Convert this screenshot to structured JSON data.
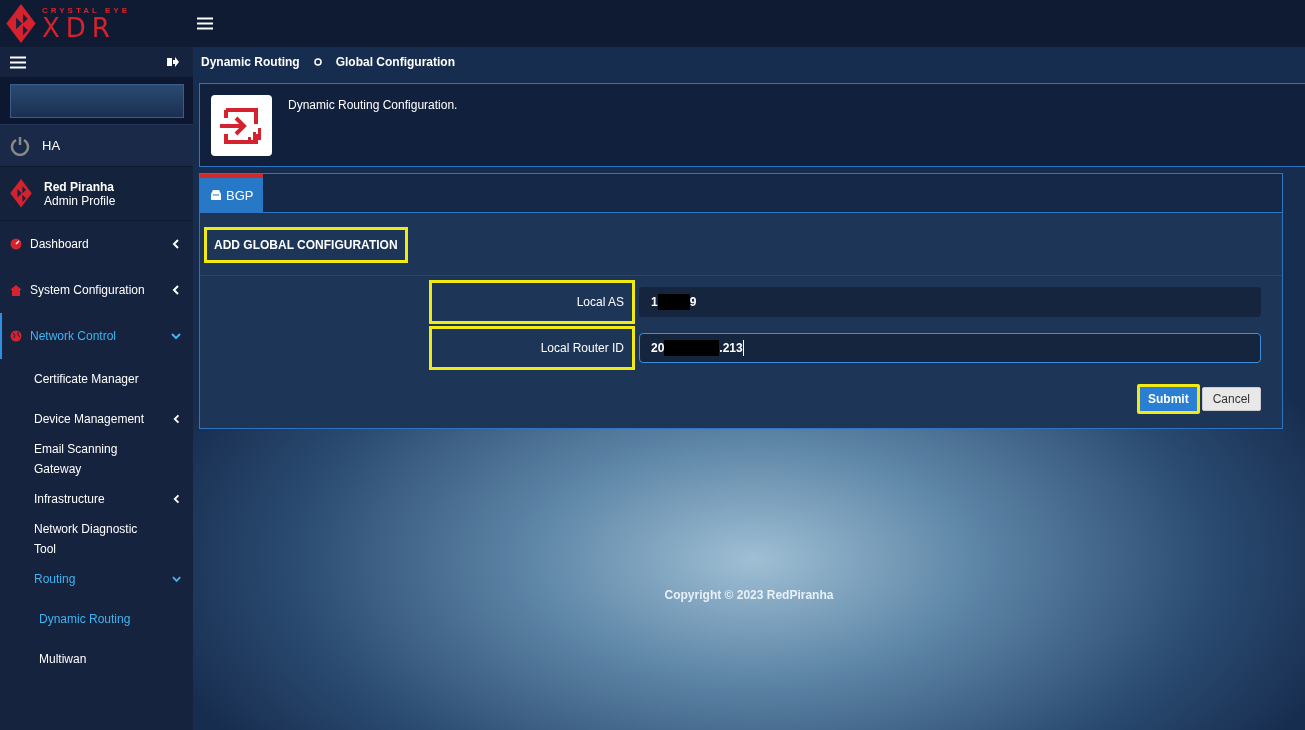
{
  "logo": {
    "tagline": "CRYSTAL EYE",
    "wordmark": "XDR"
  },
  "sidebar": {
    "ha_label": "HA",
    "profile": {
      "name": "Red Piranha",
      "role": "Admin Profile"
    },
    "items": [
      {
        "label": "Dashboard",
        "expanded": false,
        "selected": false
      },
      {
        "label": "System Configuration",
        "expanded": false,
        "selected": false
      },
      {
        "label": "Network Control",
        "expanded": true,
        "selected": true,
        "children": [
          {
            "label": "Certificate Manager",
            "selected": false
          },
          {
            "label": "Device Management",
            "expanded": false,
            "selected": false
          },
          {
            "label": "Email Scanning Gateway",
            "selected": false
          },
          {
            "label": "Infrastructure",
            "expanded": false,
            "selected": false
          },
          {
            "label": "Network Diagnostic Tool",
            "selected": false
          },
          {
            "label": "Routing",
            "expanded": true,
            "selected": true,
            "children": [
              {
                "label": "Dynamic Routing",
                "selected": true
              },
              {
                "label": "Multiwan",
                "selected": false
              }
            ]
          }
        ]
      }
    ]
  },
  "breadcrumb": [
    "Dynamic Routing",
    "Global Configuration"
  ],
  "header": {
    "description": "Dynamic Routing Configuration."
  },
  "tabs": [
    {
      "label": "BGP",
      "selected": true
    }
  ],
  "form": {
    "title": "ADD GLOBAL CONFIGURATION",
    "highlighted": true,
    "fields": [
      {
        "label": "Local AS",
        "value_start": "1",
        "value_end": "9",
        "redacted": true,
        "focused": false,
        "highlighted": true
      },
      {
        "label": "Local Router ID",
        "value_start": "20",
        "value_end": ".213",
        "redacted": true,
        "focused": true,
        "highlighted": true
      }
    ],
    "buttons": [
      {
        "label": "Submit",
        "kind": "primary",
        "highlighted": true
      },
      {
        "label": "Cancel",
        "kind": "secondary",
        "highlighted": false
      }
    ]
  },
  "footer": "Copyright © 2023 RedPiranha"
}
